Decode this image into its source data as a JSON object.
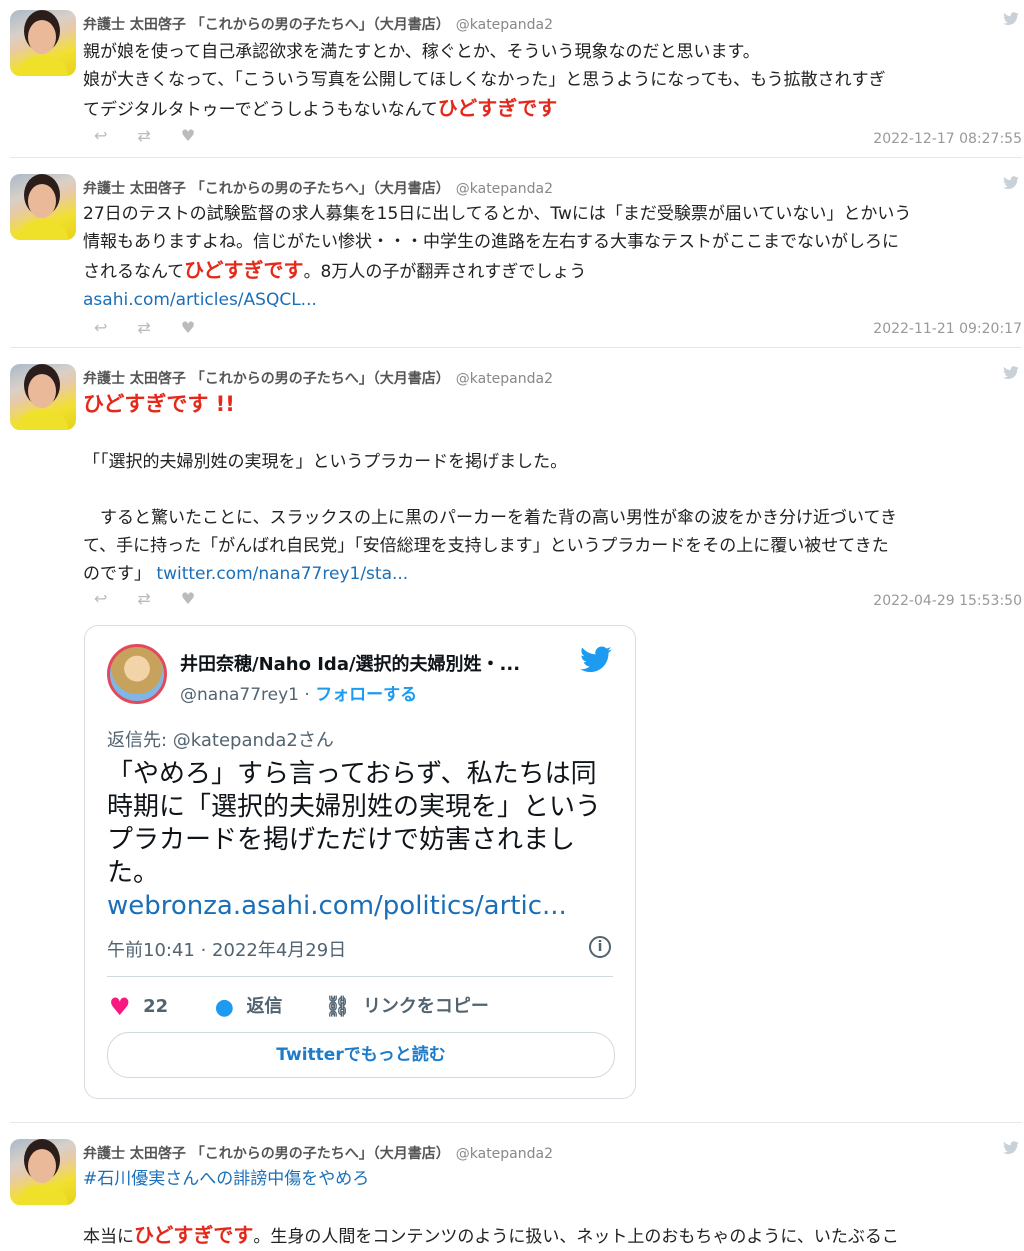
{
  "tweets": [
    {
      "name": "弁護士 太田啓子 「これからの男の子たちへ」（大月書店）",
      "handle": "@katepanda2",
      "line1": "親が娘を使って自己承認欲求を満たすとか、稼ぐとか、そういう現象なのだと思います。",
      "line2": "娘が大きくなって、「こういう写真を公開してほしくなかった」と思うようになっても、もう拡散されすぎ",
      "line3a": "てデジタルタトゥーでどうしようもないなんて",
      "red": "ひどすぎです",
      "timestamp": "2022-12-17 08:27:55"
    },
    {
      "name": "弁護士 太田啓子 「これからの男の子たちへ」（大月書店）",
      "handle": "@katepanda2",
      "line1": "27日のテストの試験監督の求人募集を15日に出してるとか、Twには「まだ受験票が届いていない」とかいう",
      "line2": "情報もありますよね。信じがたい惨状・・・中学生の進路を左右する大事なテストがここまでないがしろに",
      "line3a": "されるなんて",
      "red": "ひどすぎです",
      "line3b": "。8万人の子が翻弄されすぎでしょう",
      "link": "asahi.com/articles/ASQCL...",
      "timestamp": "2022-11-21 09:20:17"
    },
    {
      "name": "弁護士 太田啓子 「これからの男の子たちへ」（大月書店）",
      "handle": "@katepanda2",
      "red": "ひどすぎです !!",
      "quote1": "「「選択的夫婦別姓の実現を」というプラカードを掲げました。",
      "quote2": "　すると驚いたことに、スラックスの上に黒のパーカーを着た背の高い男性が傘の波をかき分け近づいてき",
      "quote3": "て、手に持った「がんばれ自民党」「安倍総理を支持します」というプラカードをその上に覆い被せてきた",
      "quote4": "のです」",
      "link": "twitter.com/nana77rey1/sta...",
      "timestamp": "2022-04-29 15:53:50"
    },
    {
      "name": "弁護士 太田啓子 「これからの男の子たちへ」（大月書店）",
      "handle": "@katepanda2",
      "hashtag": "#石川優実さんへの誹謗中傷をやめろ",
      "line1a": "本当に",
      "red": "ひどすぎです",
      "line1b": "。生身の人間をコンテンツのように扱い、ネット上のおもちゃのように、いたぶるこ"
    }
  ],
  "embed": {
    "name": "井田奈穂/Naho Ida/選択的夫婦別姓・...",
    "handle": "@nana77rey1",
    "dot": " · ",
    "follow": "フォローする",
    "reply_to": "返信先: @katepanda2さん",
    "text": "「やめろ」すら言っておらず、私たちは同時期に「選択的夫婦別姓の実現を」というプラカードを掲げただけで妨害されました。",
    "link": "webronza.asahi.com/politics/artic...",
    "date": "午前10:41 · 2022年4月29日",
    "likes": "22",
    "reply_label": "返信",
    "copy_label": "リンクをコピー",
    "read_more": "Twitterでもっと読む"
  },
  "icons": {
    "reply": "reply-icon",
    "retweet": "retweet-icon",
    "like": "heart-icon",
    "bird": "twitter-bird-icon"
  },
  "colors": {
    "red": "#e4281a",
    "link": "#1b6fb8",
    "twitter_blue": "#1d9bf0",
    "like_pink": "#f91880"
  }
}
